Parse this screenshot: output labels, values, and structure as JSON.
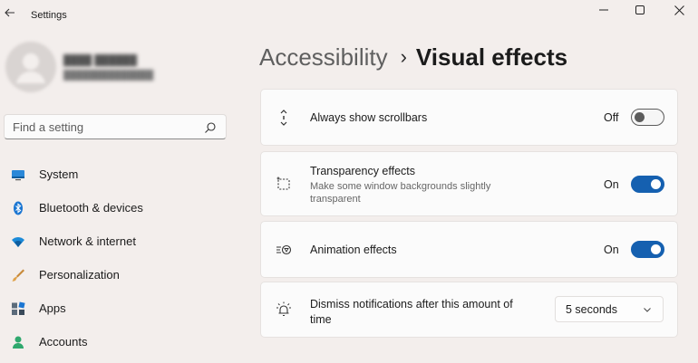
{
  "window": {
    "title": "Settings",
    "controls": [
      "minimize-icon",
      "maximize-icon",
      "close-icon"
    ]
  },
  "search": {
    "placeholder": "Find a setting"
  },
  "sidebar": {
    "items": [
      {
        "label": "System",
        "icon": "monitor-icon"
      },
      {
        "label": "Bluetooth & devices",
        "icon": "bluetooth-icon"
      },
      {
        "label": "Network & internet",
        "icon": "wifi-icon"
      },
      {
        "label": "Personalization",
        "icon": "brush-icon"
      },
      {
        "label": "Apps",
        "icon": "apps-icon"
      },
      {
        "label": "Accounts",
        "icon": "person-icon"
      }
    ]
  },
  "breadcrumb": {
    "parent": "Accessibility",
    "separator": "›",
    "current": "Visual effects"
  },
  "settings": [
    {
      "title": "Always show scrollbars",
      "state": "Off",
      "icon": "scrollbar-icon"
    },
    {
      "title": "Transparency effects",
      "description": "Make some window backgrounds slightly transparent",
      "state": "On",
      "icon": "transparency-icon"
    },
    {
      "title": "Animation effects",
      "state": "On",
      "icon": "animation-icon"
    },
    {
      "title": "Dismiss notifications after this amount of time",
      "value": "5 seconds",
      "icon": "notification-bell-icon"
    }
  ],
  "colors": {
    "accent": "#1560b0",
    "background": "#f3eeec",
    "card": "#fbfbfb"
  }
}
